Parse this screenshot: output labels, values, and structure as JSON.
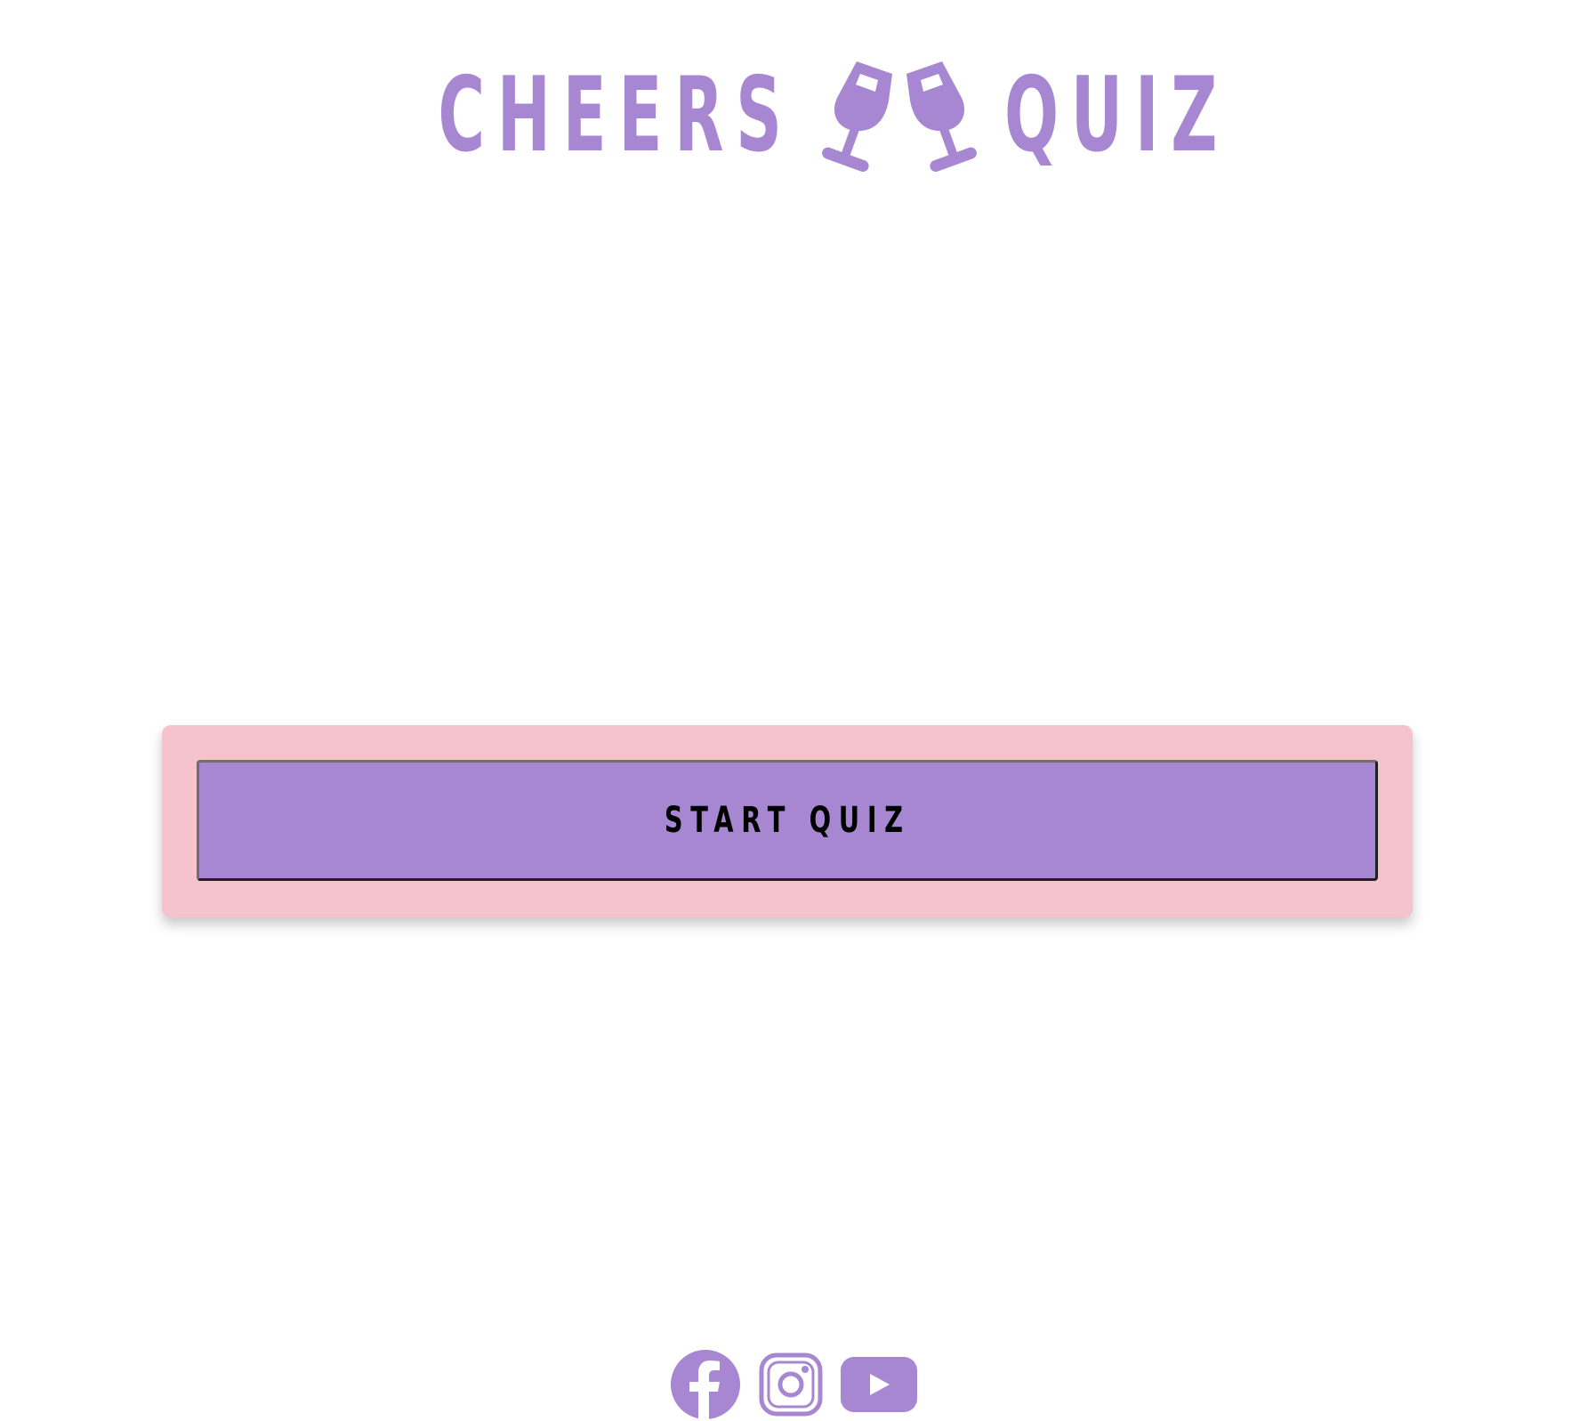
{
  "header": {
    "title_left": "CHEERS",
    "title_right": "QUIZ",
    "icon": "glasses-cheers-icon"
  },
  "main": {
    "start_button_label": "START QUIZ"
  },
  "footer": {
    "social_icons": [
      "facebook-icon",
      "instagram-icon",
      "youtube-icon"
    ]
  },
  "colors": {
    "accent": "#a787d1",
    "card_background": "#f4c3cc",
    "page_background": "#ffffff"
  }
}
